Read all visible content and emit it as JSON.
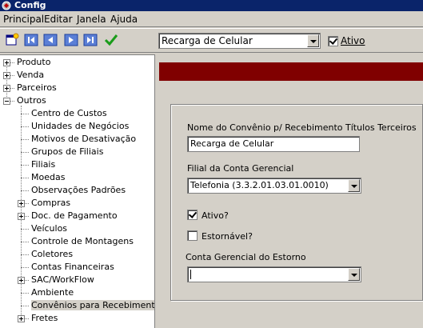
{
  "window": {
    "title": "Config"
  },
  "menu": [
    "Principal",
    "Editar",
    "Janela",
    "Ajuda"
  ],
  "toolbar": {
    "buttons": [
      "new-icon",
      "first-icon",
      "previous-icon",
      "next-icon",
      "last-icon",
      "confirm-icon"
    ],
    "record_select": "Recarga de Celular",
    "ativo_label": "Ativo",
    "ativo_checked": true
  },
  "tree": {
    "items": [
      {
        "label": "Produto",
        "level": 0,
        "expander": "plus"
      },
      {
        "label": "Venda",
        "level": 0,
        "expander": "plus"
      },
      {
        "label": "Parceiros",
        "level": 0,
        "expander": "plus"
      },
      {
        "label": "Outros",
        "level": 0,
        "expander": "minus"
      },
      {
        "label": "Centro de Custos",
        "level": 1
      },
      {
        "label": "Unidades de Negócios",
        "level": 1
      },
      {
        "label": "Motivos de Desativação",
        "level": 1
      },
      {
        "label": "Grupos de Filiais",
        "level": 1
      },
      {
        "label": "Filiais",
        "level": 1
      },
      {
        "label": "Moedas",
        "level": 1
      },
      {
        "label": "Observações Padrões",
        "level": 1
      },
      {
        "label": "Compras",
        "level": 1,
        "expander": "plus"
      },
      {
        "label": "Doc. de Pagamento",
        "level": 1,
        "expander": "plus"
      },
      {
        "label": "Veículos",
        "level": 1
      },
      {
        "label": "Controle de Montagens",
        "level": 1
      },
      {
        "label": "Coletores",
        "level": 1
      },
      {
        "label": "Contas Financeiras",
        "level": 1
      },
      {
        "label": "SAC/WorkFlow",
        "level": 1,
        "expander": "plus"
      },
      {
        "label": "Ambiente",
        "level": 1
      },
      {
        "label": "Convênios para Recebimentos de Títulos Terceiros",
        "level": 1,
        "selected": true
      },
      {
        "label": "Fretes",
        "level": 1,
        "expander": "plus"
      }
    ]
  },
  "form": {
    "name_label": "Nome do Convênio p/ Recebimento Títulos Terceiros",
    "name_value": "Recarga de Celular",
    "filial_label": "Filial da Conta Gerencial",
    "filial_value": "Telefonia (3.3.2.01.03.01.0010)",
    "ativo_label": "Ativo?",
    "ativo_checked": true,
    "estornavel_label": "Estornável?",
    "estornavel_checked": false,
    "estorno_label": "Conta Gerencial do Estorno",
    "estorno_value": ""
  },
  "colors": {
    "banner": "#800000",
    "titlebar": "#0a246a"
  }
}
